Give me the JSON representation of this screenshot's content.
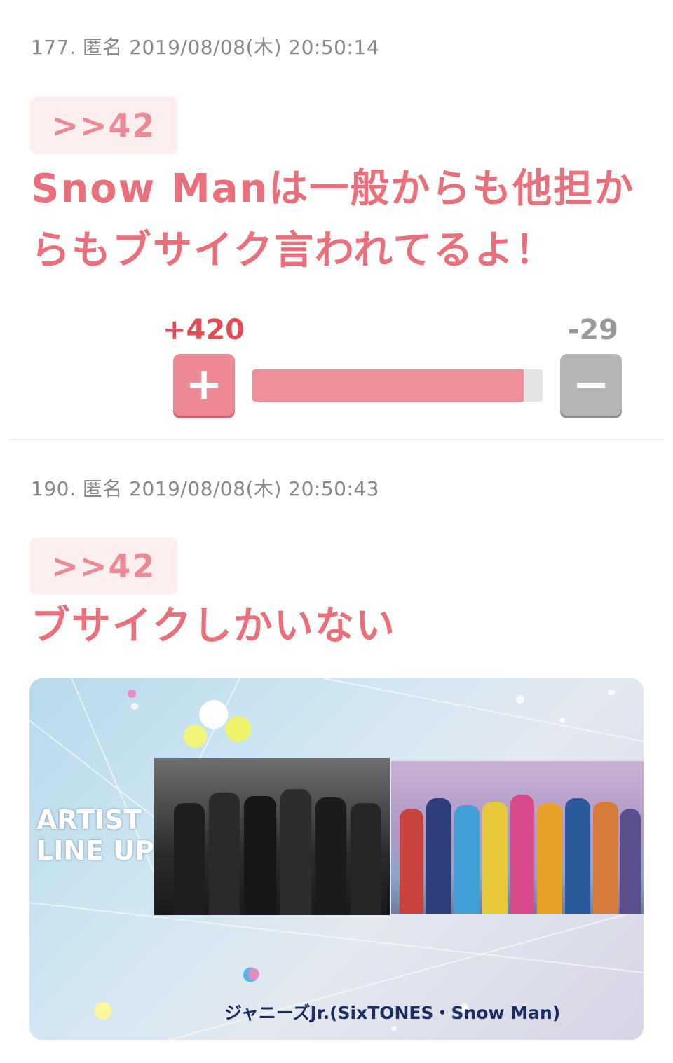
{
  "comments": [
    {
      "meta": "177. 匿名 2019/08/08(木) 20:50:14",
      "anchor": ">>42",
      "text": "Snow Manは一般からも他担からもブサイク言われてるよ！",
      "plus": "+420",
      "minus": "-29",
      "plus_ratio": 0.935
    },
    {
      "meta": "190. 匿名 2019/08/08(木) 20:50:43",
      "anchor": ">>42",
      "text": "ブサイクしかいない",
      "image": {
        "label_line1": "ARTIST",
        "label_line2": "LINE UP",
        "caption": "ジャニーズJr.(SixTONES・Snow Man)"
      }
    }
  ],
  "vote_buttons": {
    "plus_symbol": "+",
    "minus_symbol": "−"
  },
  "colors": {
    "accent": "#ea6f7d",
    "bar": "#ee8e98",
    "minus": "#b5b5b5"
  }
}
